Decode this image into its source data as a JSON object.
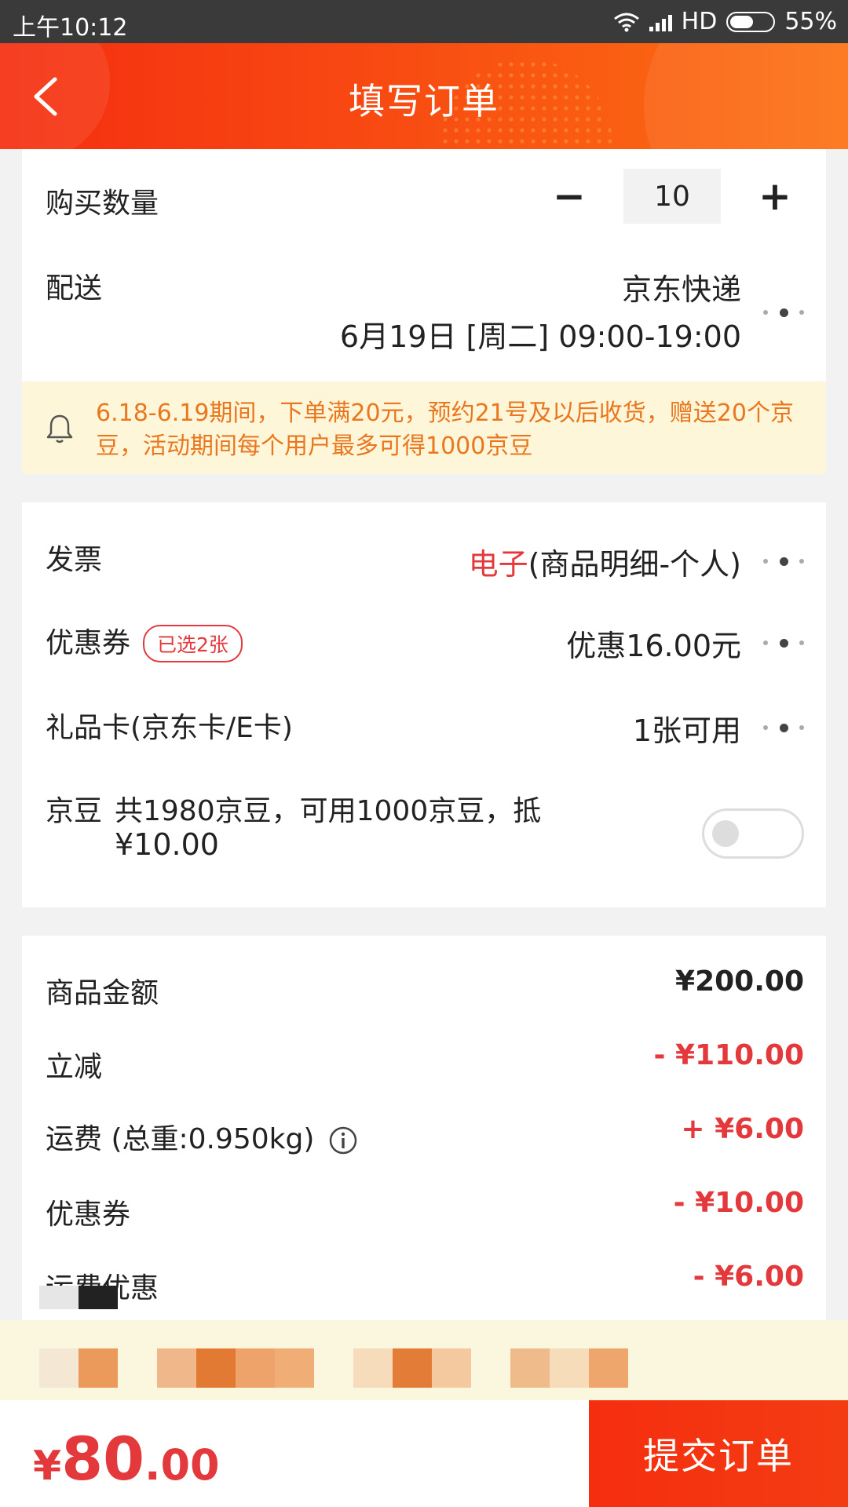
{
  "status": {
    "time": "上午10:12",
    "network": "HD",
    "battery": "55%"
  },
  "header": {
    "title": "填写订单"
  },
  "quantity": {
    "label": "购买数量",
    "minus": "−",
    "value": "10",
    "plus": "+"
  },
  "delivery": {
    "label": "配送",
    "carrier": "京东快递",
    "time": "6月19日 [周二] 09:00-19:00"
  },
  "notice": {
    "text": "6.18-6.19期间，下单满20元，预约21号及以后收货，赠送20个京豆，活动期间每个用户最多可得1000京豆"
  },
  "invoice": {
    "label": "发票",
    "type": "电子",
    "detail": "(商品明细-个人)"
  },
  "coupon": {
    "label": "优惠券",
    "tag": "已选2张",
    "value": "优惠16.00元"
  },
  "giftcard": {
    "label": "礼品卡(京东卡/E卡)",
    "value": "1张可用"
  },
  "jingdou": {
    "label": "京豆",
    "line1": "共1980京豆，可用1000京豆，抵",
    "line2": "¥10.00",
    "enabled": false
  },
  "summary": {
    "goods_label": "商品金额",
    "goods_value": "¥200.00",
    "discount_label": "立减",
    "discount_value": "- ¥110.00",
    "shipping_label": "运费 (总重:0.950kg)",
    "shipping_value": "+ ¥6.00",
    "coupon_label": "优惠券",
    "coupon_value": "- ¥10.00",
    "shipping_discount_label": "运费优惠",
    "shipping_discount_value": "- ¥6.00"
  },
  "bottom": {
    "currency": "¥",
    "total_int": "80",
    "total_dec": ".00",
    "submit_label": "提交订单"
  },
  "colors": {
    "brand_red": "#e4393c",
    "header_start": "#f52e10",
    "header_end": "#fc7213",
    "notice_bg": "#fdf6d8",
    "notice_text": "#e9771f"
  }
}
